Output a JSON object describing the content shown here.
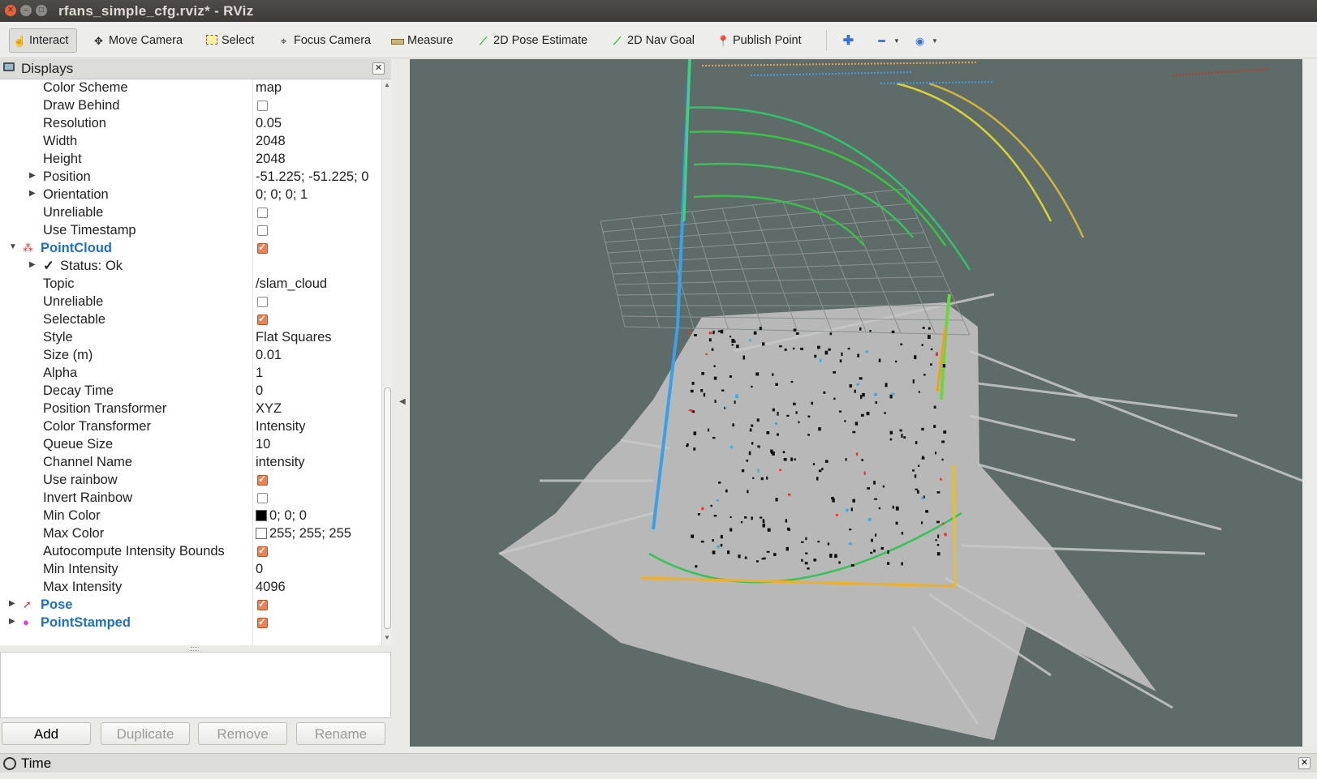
{
  "window": {
    "title": "rfans_simple_cfg.rviz* - RViz"
  },
  "toolbar": {
    "interact": "Interact",
    "move_camera": "Move Camera",
    "select": "Select",
    "focus_camera": "Focus Camera",
    "measure": "Measure",
    "pose_estimate": "2D Pose Estimate",
    "nav_goal": "2D Nav Goal",
    "publish_point": "Publish Point"
  },
  "displays": {
    "title": "Displays",
    "rows": [
      {
        "key": "Color Scheme",
        "value": "map"
      },
      {
        "key": "Draw Behind",
        "check": false
      },
      {
        "key": "Resolution",
        "value": "0.05"
      },
      {
        "key": "Width",
        "value": "2048"
      },
      {
        "key": "Height",
        "value": "2048"
      },
      {
        "key": "Position",
        "value": "-51.225; -51.225; 0",
        "expandable": true
      },
      {
        "key": "Orientation",
        "value": "0; 0; 0; 1",
        "expandable": true
      },
      {
        "key": "Unreliable",
        "check": false
      },
      {
        "key": "Use Timestamp",
        "check": false
      },
      {
        "key": "PointCloud",
        "check": true,
        "group": true
      },
      {
        "key": "Status: Ok",
        "status": true
      },
      {
        "key": "Topic",
        "value": "/slam_cloud"
      },
      {
        "key": "Unreliable",
        "check": false
      },
      {
        "key": "Selectable",
        "check": true
      },
      {
        "key": "Style",
        "value": "Flat Squares"
      },
      {
        "key": "Size (m)",
        "value": "0.01"
      },
      {
        "key": "Alpha",
        "value": "1"
      },
      {
        "key": "Decay Time",
        "value": "0"
      },
      {
        "key": "Position Transformer",
        "value": "XYZ"
      },
      {
        "key": "Color Transformer",
        "value": "Intensity"
      },
      {
        "key": "Queue Size",
        "value": "10"
      },
      {
        "key": "Channel Name",
        "value": "intensity"
      },
      {
        "key": "Use rainbow",
        "check": true
      },
      {
        "key": "Invert Rainbow",
        "check": false
      },
      {
        "key": "Min Color",
        "value": "0; 0; 0",
        "swatch": "#000000"
      },
      {
        "key": "Max Color",
        "value": "255; 255; 255",
        "swatch": "#ffffff"
      },
      {
        "key": "Autocompute Intensity Bounds",
        "check": true
      },
      {
        "key": "Min Intensity",
        "value": "0"
      },
      {
        "key": "Max Intensity",
        "value": "4096"
      },
      {
        "key": "Pose",
        "check": true,
        "group": true,
        "icon": "arrow"
      },
      {
        "key": "PointStamped",
        "check": true,
        "group": true,
        "icon": "dot"
      }
    ],
    "buttons": {
      "add": "Add",
      "duplicate": "Duplicate",
      "remove": "Remove",
      "rename": "Rename"
    }
  },
  "time_panel": {
    "title": "Time"
  },
  "colors": {
    "viewport_bg": "#5f6b69",
    "group_label": "#1f6fc5",
    "checkbox_on": "#ec8055"
  }
}
